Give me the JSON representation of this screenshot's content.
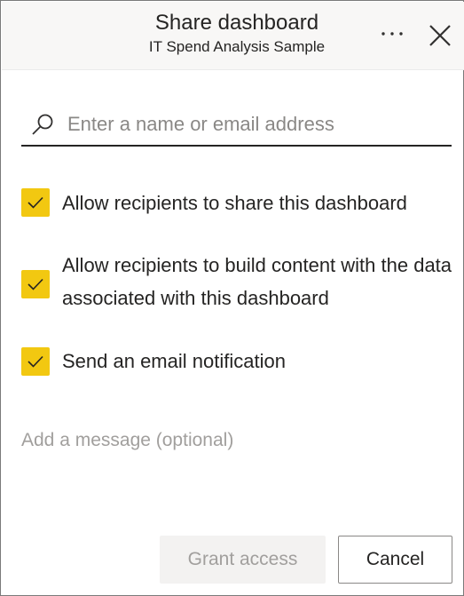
{
  "header": {
    "title": "Share dashboard",
    "subtitle": "IT Spend Analysis Sample",
    "more_icon": "ellipsis-icon",
    "close_icon": "close-icon"
  },
  "search": {
    "placeholder": "Enter a name or email address",
    "value": "",
    "icon": "search-icon"
  },
  "options": [
    {
      "label": "Allow recipients to share this dashboard",
      "checked": true
    },
    {
      "label": "Allow recipients to build content with the data associated with this dashboard",
      "checked": true
    },
    {
      "label": "Send an email notification",
      "checked": true
    }
  ],
  "message": {
    "placeholder": "Add a message (optional)",
    "value": ""
  },
  "buttons": {
    "grant": "Grant access",
    "cancel": "Cancel"
  },
  "colors": {
    "checkbox": "#f2c811",
    "header_bg": "#f8f7f6",
    "grant_disabled_bg": "#f3f2f1",
    "grant_disabled_text": "#a19f9d"
  }
}
